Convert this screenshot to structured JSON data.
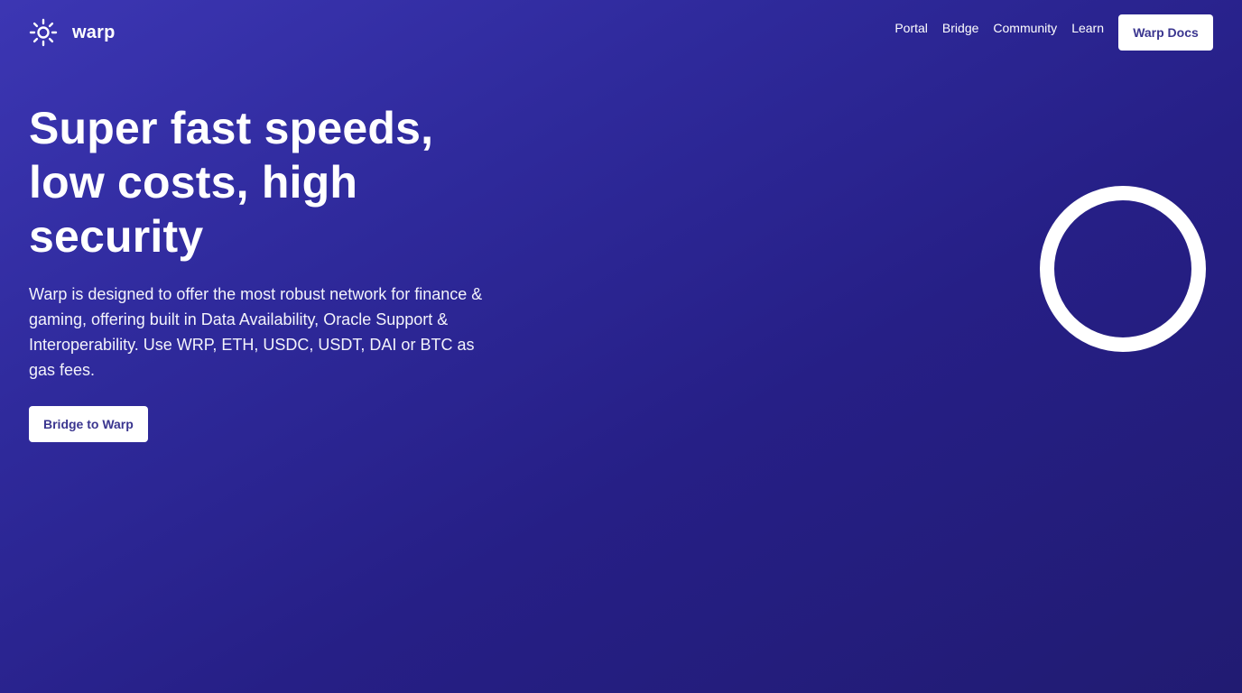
{
  "brand": {
    "logo_icon": "sun-icon",
    "name": "warp"
  },
  "nav": {
    "links": [
      {
        "label": "Portal"
      },
      {
        "label": "Bridge"
      },
      {
        "label": "Community"
      },
      {
        "label": "Learn"
      }
    ],
    "cta_label": "Warp Docs"
  },
  "hero": {
    "title": "Super fast speeds, low costs, high security",
    "description": "Warp is designed to offer the most robust network for finance & gaming, offering built in Data Availability, Oracle Support & Interoperability. Use WRP, ETH, USDC, USDT, DAI or BTC as gas fees.",
    "cta_label": "Bridge to Warp"
  },
  "decoration": {
    "ring_icon": "ring-graphic"
  },
  "colors": {
    "background_start": "#3c36b3",
    "background_end": "#211b72",
    "button_background": "#ffffff",
    "button_text": "#3a358f"
  }
}
